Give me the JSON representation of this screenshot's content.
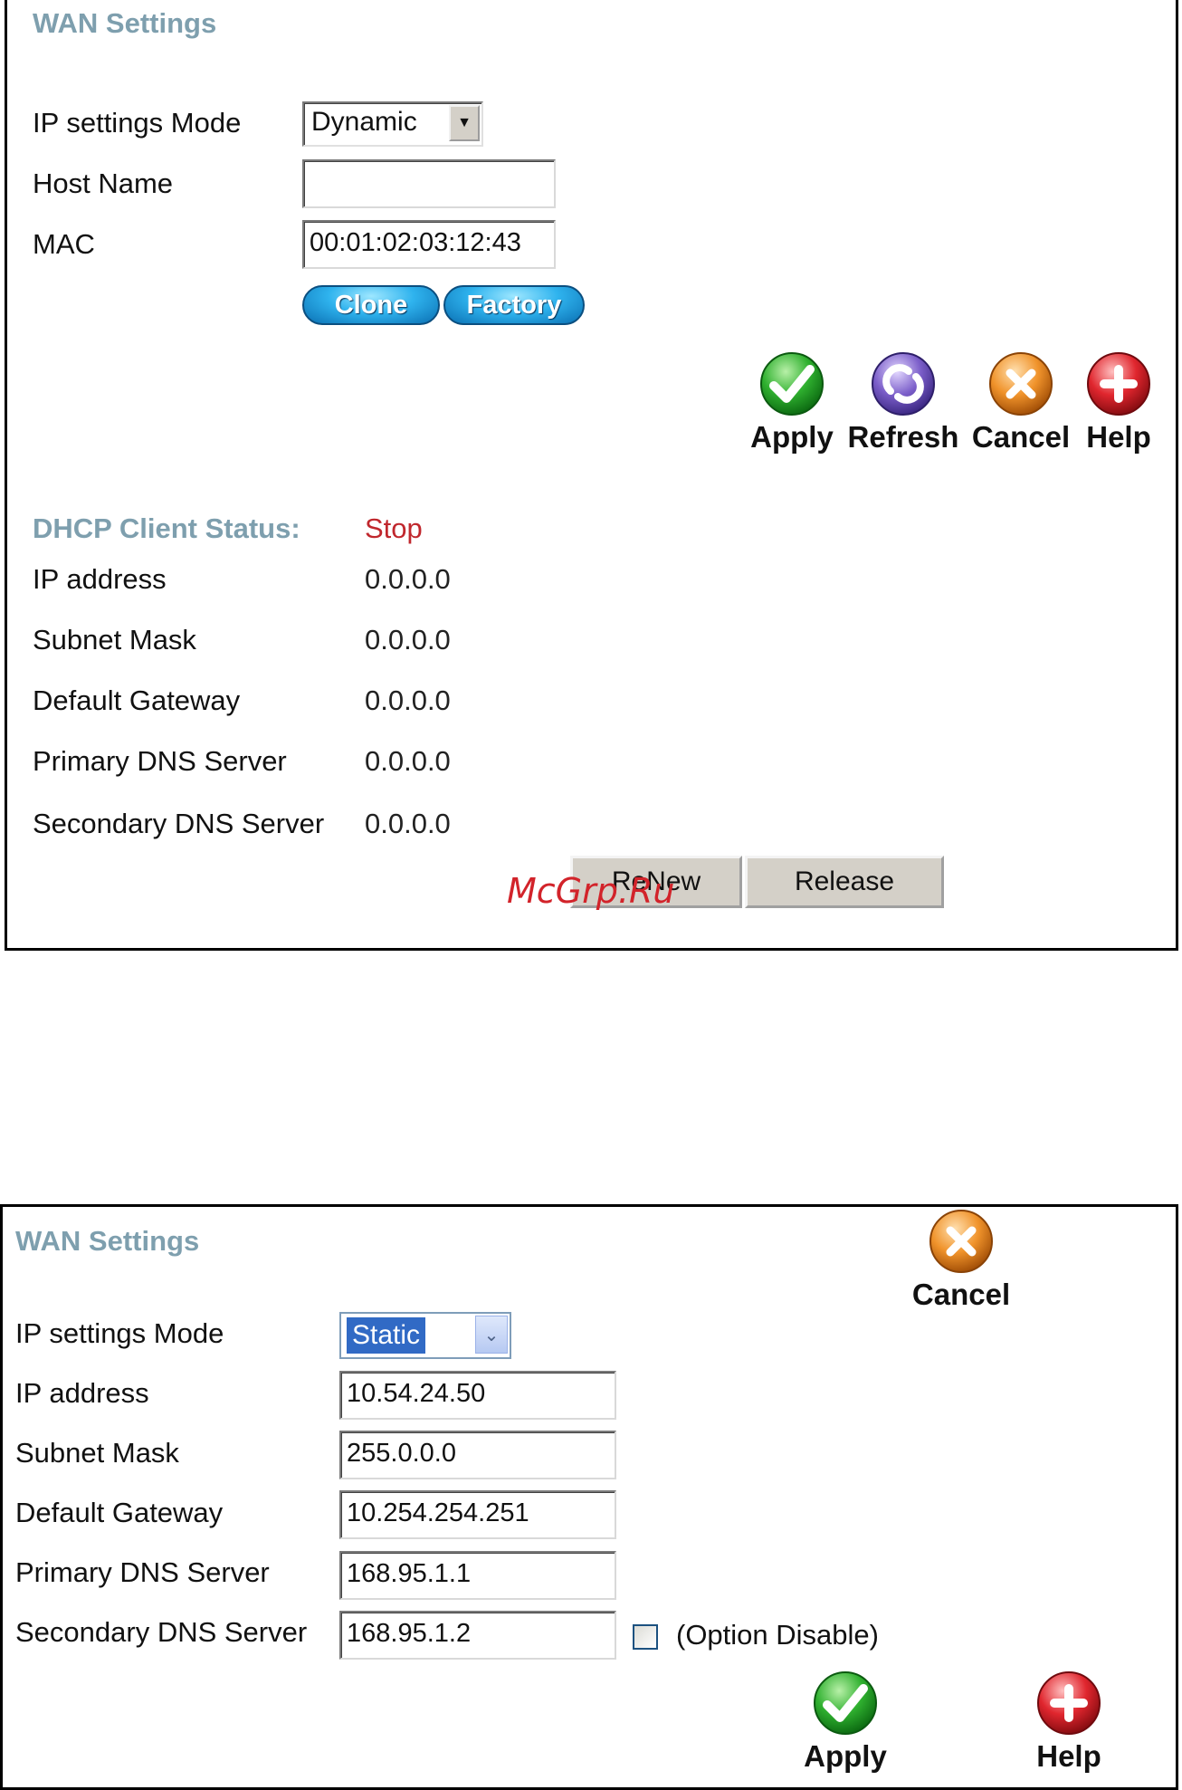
{
  "dynamic_panel": {
    "title": "WAN Settings",
    "ip_mode": {
      "label": "IP settings Mode",
      "value": "Dynamic"
    },
    "host_name": {
      "label": "Host Name",
      "value": ""
    },
    "mac": {
      "label": "MAC",
      "value": "00:01:02:03:12:43"
    },
    "clone_label": "Clone",
    "factory_label": "Factory",
    "actions": {
      "apply": "Apply",
      "refresh": "Refresh",
      "cancel": "Cancel",
      "help": "Help"
    },
    "dhcp_status": {
      "label": "DHCP Client Status:",
      "value": "Stop"
    },
    "status_rows": [
      {
        "label": "IP address",
        "value": "0.0.0.0"
      },
      {
        "label": "Subnet Mask",
        "value": "0.0.0.0"
      },
      {
        "label": "Default Gateway",
        "value": "0.0.0.0"
      },
      {
        "label": "Primary DNS Server",
        "value": "0.0.0.0"
      },
      {
        "label": "Secondary DNS Server",
        "value": "0.0.0.0"
      }
    ],
    "renew_label": "ReNew",
    "release_label": "Release"
  },
  "watermark": "McGrp.Ru",
  "static_panel": {
    "title": "WAN Settings",
    "ip_mode": {
      "label": "IP settings Mode",
      "value": "Static"
    },
    "fields": [
      {
        "label": "IP address",
        "value": "10.54.24.50"
      },
      {
        "label": "Subnet Mask",
        "value": "255.0.0.0"
      },
      {
        "label": "Default Gateway",
        "value": "10.254.254.251"
      },
      {
        "label": "Primary DNS Server",
        "value": "168.95.1.1"
      },
      {
        "label": "Secondary DNS Server",
        "value": "168.95.1.2"
      }
    ],
    "option_disable_label": "(Option Disable)",
    "option_disable_checked": false,
    "actions": {
      "apply": "Apply",
      "cancel": "Cancel",
      "help": "Help"
    }
  },
  "icons": {
    "apply": "check-icon",
    "refresh": "refresh-icon",
    "cancel": "cancel-x-icon",
    "help": "help-plus-icon"
  },
  "colors": {
    "title": "#7e9fae",
    "status_stop": "#c0272d",
    "apply_icon": "#2fb02f",
    "refresh_icon": "#7b5ec9",
    "cancel_icon": "#f0932b",
    "help_icon": "#e0262e",
    "select_highlight": "#316ac5"
  }
}
